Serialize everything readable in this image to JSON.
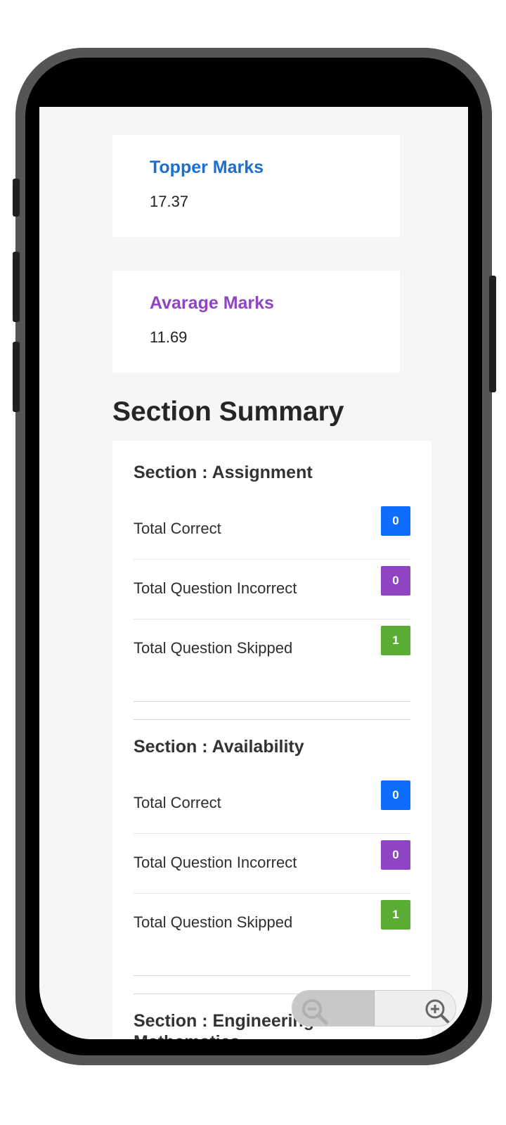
{
  "cards": {
    "topper": {
      "label": "Topper Marks",
      "value": "17.37"
    },
    "average": {
      "label": "Avarage Marks",
      "value": "11.69"
    }
  },
  "section_summary": {
    "heading": "Section Summary",
    "sections": [
      {
        "title": "Section : Assignment",
        "rows": [
          {
            "label": "Total Correct",
            "count": "0"
          },
          {
            "label": "Total Question Incorrect",
            "count": "0"
          },
          {
            "label": "Total Question Skipped",
            "count": "1"
          }
        ]
      },
      {
        "title": "Section : Availability",
        "rows": [
          {
            "label": "Total Correct",
            "count": "0"
          },
          {
            "label": "Total Question Incorrect",
            "count": "0"
          },
          {
            "label": "Total Question Skipped",
            "count": "1"
          }
        ]
      },
      {
        "title": "Section : Engineering Mathematics"
      }
    ]
  },
  "colors": {
    "correct": "#0d6efd",
    "incorrect": "#8e44c4",
    "skipped": "#5aad34",
    "topper_label": "#1a6fd1",
    "average_label": "#8e44c4"
  },
  "icons": {
    "zoom_out": "zoom-out-icon",
    "zoom_in": "zoom-in-icon"
  }
}
